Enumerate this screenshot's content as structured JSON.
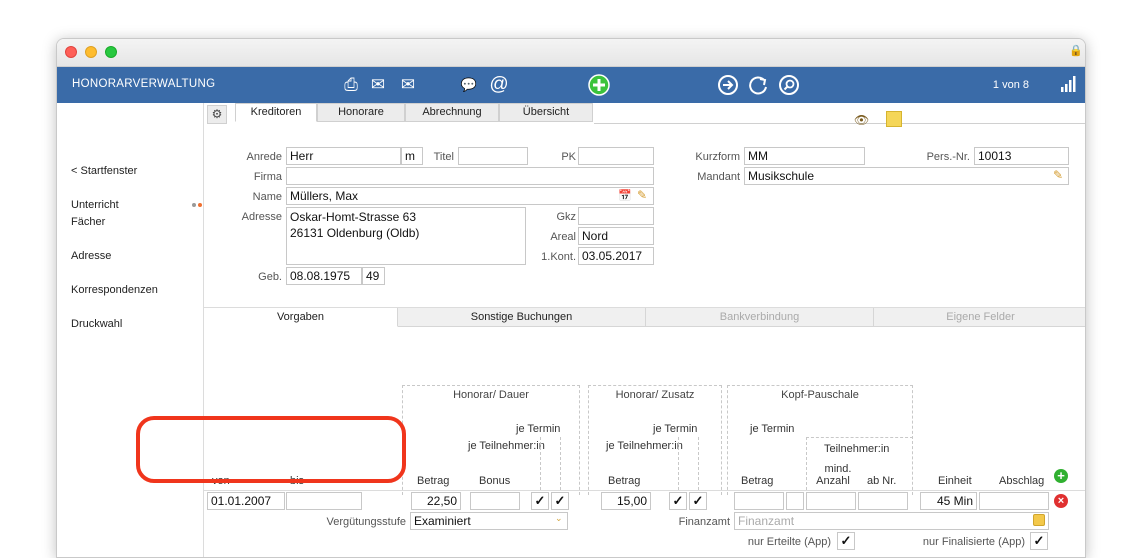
{
  "app_title": "HONORARVERWALTUNG",
  "pager": "1 von 8",
  "sidebar": {
    "items": [
      "< Startfenster",
      "Unterricht",
      "Fächer",
      "Adresse",
      "Korrespondenzen",
      "Druckwahl"
    ]
  },
  "tabs_top": [
    "Kreditoren",
    "Honorare",
    "Abrechnung",
    "Übersicht"
  ],
  "form": {
    "anrede_label": "Anrede",
    "anrede": "Herr",
    "gender": "m",
    "titel_label": "Titel",
    "titel": "",
    "pk_label": "PK",
    "pk": "",
    "firma_label": "Firma",
    "firma": "",
    "name_label": "Name",
    "name": "Müllers, Max",
    "adresse_label": "Adresse",
    "adresse_line1": "Oskar-Homt-Strasse 63",
    "adresse_line2": "26131 Oldenburg (Oldb)",
    "gkz_label": "Gkz",
    "gkz": "",
    "areal_label": "Areal",
    "areal": "Nord",
    "kont_label": "1.Kont.",
    "kont": "03.05.2017",
    "geb_label": "Geb.",
    "geb": "08.08.1975",
    "age": "49",
    "kurzform_label": "Kurzform",
    "kurzform": "MM",
    "persnr_label": "Pers.-Nr.",
    "persnr": "10013",
    "mandant_label": "Mandant",
    "mandant": "Musikschule"
  },
  "tabs_bottom": [
    "Vorgaben",
    "Sonstige Buchungen",
    "Bankverbindung",
    "Eigene Felder"
  ],
  "groups": {
    "honorar_dauer": "Honorar/ Dauer",
    "honorar_zusatz": "Honorar/ Zusatz",
    "kopf_pauschale": "Kopf-Pauschale"
  },
  "columns": {
    "je_termin": "je Termin",
    "je_teilnehmer": "je Teilnehmer:in",
    "teilnehmer": "Teilnehmer:in",
    "von": "von",
    "bis": "bis",
    "betrag": "Betrag",
    "bonus": "Bonus",
    "mind_anzahl_1": "mind.",
    "mind_anzahl_2": "Anzahl",
    "ab_nr": "ab Nr.",
    "einheit": "Einheit",
    "abschlag": "Abschlag"
  },
  "row": {
    "von": "01.01.2007",
    "bis": "",
    "betrag_dauer": "22,50",
    "bonus": "",
    "betrag_zusatz": "15,00",
    "einheit": "45 Min",
    "check": "✓"
  },
  "verguetung_label": "Vergütungsstufe",
  "verguetung": "Examiniert",
  "finanzamt_label": "Finanzamt",
  "finanzamt_placeholder": "Finanzamt",
  "nur_erteilte": "nur Erteilte (App)",
  "nur_finalisierte": "nur Finalisierte (App)"
}
